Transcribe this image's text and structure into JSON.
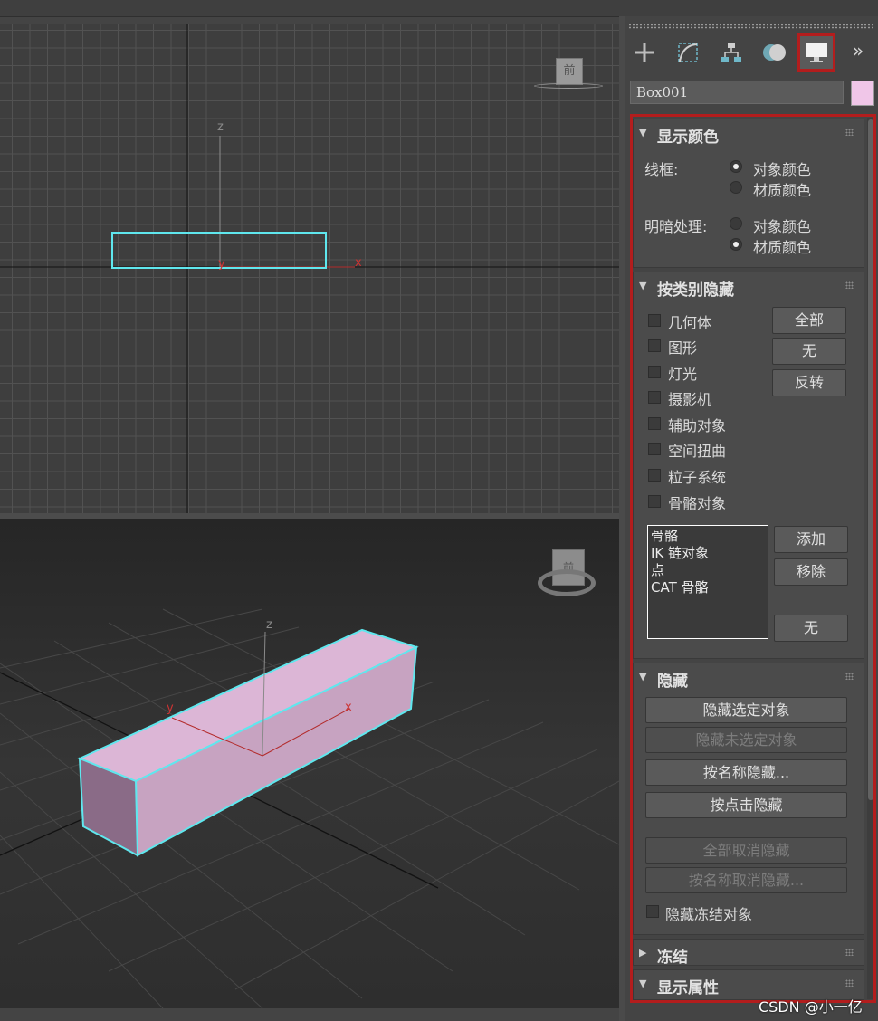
{
  "object": {
    "name": "Box001",
    "color": "#f0c6e8"
  },
  "viewport_top": {
    "axis_z": "z",
    "axis_x": "x",
    "axis_y": "y",
    "cube_face": "前"
  },
  "viewport_persp": {
    "axis_z": "z",
    "axis_x": "x",
    "axis_y": "y",
    "cube_face": "前"
  },
  "tabs": {
    "items": [
      "create-tab",
      "modify-tab",
      "hierarchy-tab",
      "motion-tab",
      "display-tab"
    ],
    "active": "display-tab",
    "more": "»"
  },
  "display_color": {
    "title": "显示颜色",
    "wireframe_label": "线框:",
    "shaded_label": "明暗处理:",
    "opt_object": "对象颜色",
    "opt_material": "材质颜色"
  },
  "hide_by_category": {
    "title": "按类别隐藏",
    "items": [
      "几何体",
      "图形",
      "灯光",
      "摄影机",
      "辅助对象",
      "空间扭曲",
      "粒子系统",
      "骨骼对象"
    ],
    "btn_all": "全部",
    "btn_none": "无",
    "btn_invert": "反转",
    "list": [
      "骨骼",
      "IK 链对象",
      "点",
      "CAT 骨骼"
    ],
    "btn_add": "添加",
    "btn_remove": "移除",
    "btn_none2": "无"
  },
  "hide": {
    "title": "隐藏",
    "hide_selected": "隐藏选定对象",
    "hide_unselected": "隐藏未选定对象",
    "hide_by_name": "按名称隐藏...",
    "hide_by_hit": "按点击隐藏",
    "unhide_all": "全部取消隐藏",
    "unhide_by_name": "按名称取消隐藏...",
    "hide_frozen": "隐藏冻结对象"
  },
  "freeze": {
    "title": "冻结"
  },
  "display_props": {
    "title": "显示属性"
  },
  "accent": "#b31d1d",
  "watermark": "CSDN @小一亿"
}
